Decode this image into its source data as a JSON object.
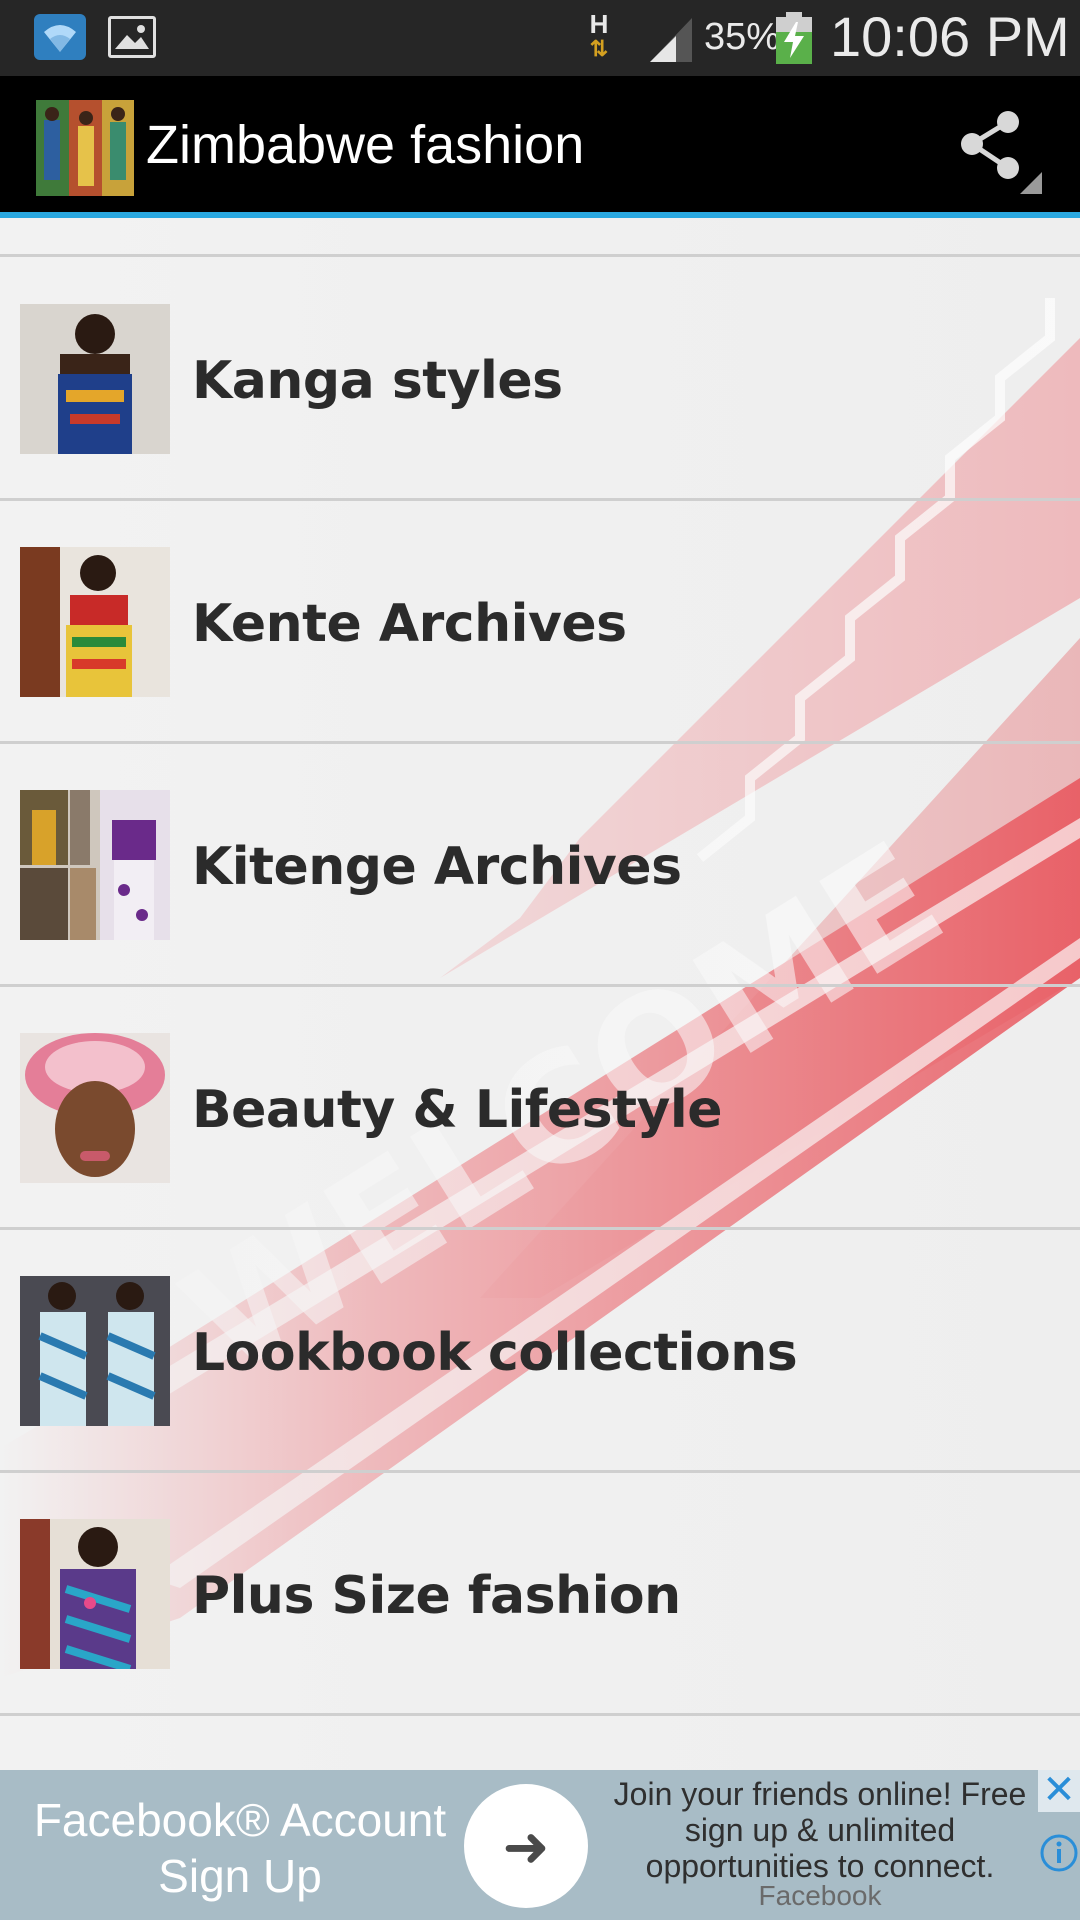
{
  "status_bar": {
    "network_type": "H",
    "battery_percent": "35%",
    "time": "10:06 PM",
    "icons": [
      "wifi-icon",
      "gallery-icon",
      "data-transfer-icon",
      "cell-signal-icon",
      "battery-charging-icon"
    ]
  },
  "app_bar": {
    "title": "Zimbabwe fashion",
    "share_icon": "share-icon"
  },
  "list": {
    "items": [
      {
        "label": ""
      },
      {
        "label": "Kanga styles"
      },
      {
        "label": "Kente Archives"
      },
      {
        "label": "Kitenge Archives"
      },
      {
        "label": "Beauty & Lifestyle"
      },
      {
        "label": "Lookbook collections"
      },
      {
        "label": "Plus Size fashion"
      }
    ]
  },
  "ad": {
    "left_line1": "Facebook® Account",
    "left_line2": "Sign Up",
    "right_text": "Join your friends online! Free sign up & unlimited opportunities to connect.",
    "brand": "Facebook"
  },
  "colors": {
    "status_bar": "#262626",
    "app_bar": "#000000",
    "accent_line": "#2aa8e0",
    "ad_bg": "#a8bcc6",
    "carpet_red": "#e4474f"
  }
}
